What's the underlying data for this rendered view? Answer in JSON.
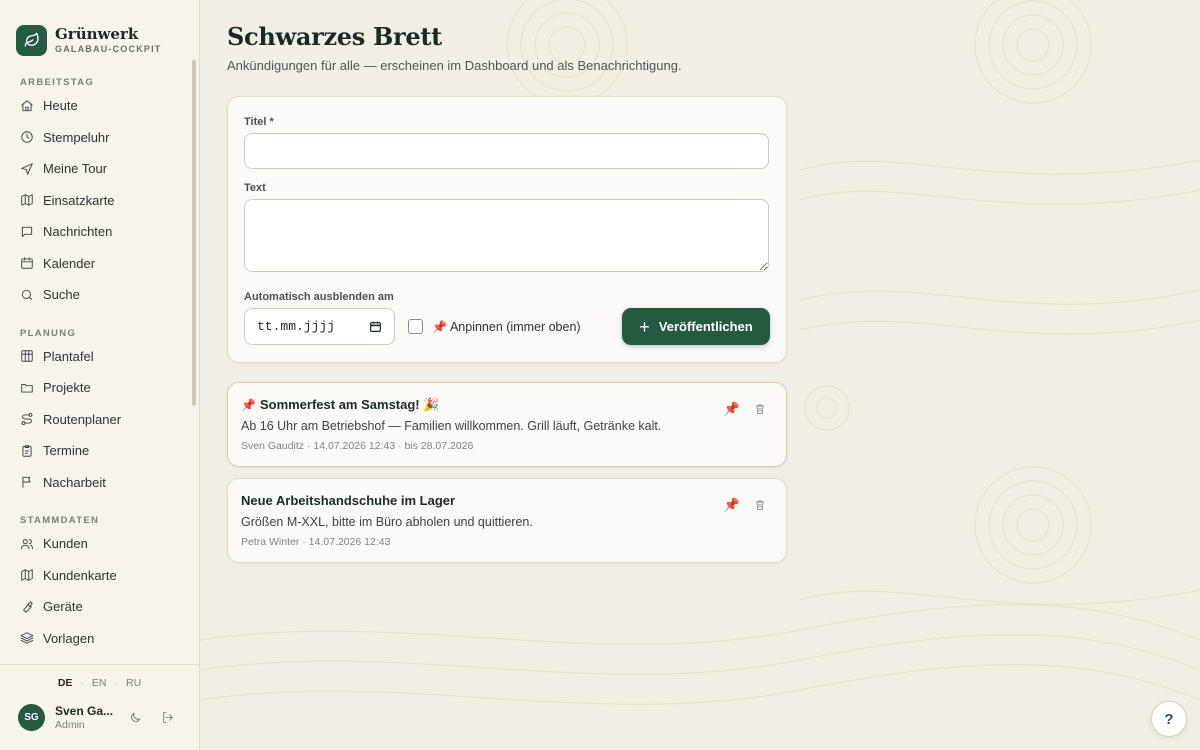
{
  "brand": {
    "name": "Grünwerk",
    "subtitle": "GALABAU-COCKPIT"
  },
  "sidebar": {
    "sections": [
      {
        "title": "ARBEITSTAG",
        "items": [
          {
            "label": "Heute",
            "icon": "home-icon"
          },
          {
            "label": "Stempeluhr",
            "icon": "clock-icon"
          },
          {
            "label": "Meine Tour",
            "icon": "navigation-icon"
          },
          {
            "label": "Einsatzkarte",
            "icon": "map-icon"
          },
          {
            "label": "Nachrichten",
            "icon": "message-icon"
          },
          {
            "label": "Kalender",
            "icon": "calendar-icon"
          },
          {
            "label": "Suche",
            "icon": "search-icon"
          }
        ]
      },
      {
        "title": "PLANUNG",
        "items": [
          {
            "label": "Plantafel",
            "icon": "grid-icon"
          },
          {
            "label": "Projekte",
            "icon": "folder-icon"
          },
          {
            "label": "Routenplaner",
            "icon": "route-icon"
          },
          {
            "label": "Termine",
            "icon": "clipboard-icon"
          },
          {
            "label": "Nacharbeit",
            "icon": "flag-icon"
          }
        ]
      },
      {
        "title": "STAMMDATEN",
        "items": [
          {
            "label": "Kunden",
            "icon": "users-icon"
          },
          {
            "label": "Kundenkarte",
            "icon": "map-icon"
          },
          {
            "label": "Geräte",
            "icon": "wrench-icon"
          },
          {
            "label": "Vorlagen",
            "icon": "layers-icon"
          }
        ]
      }
    ],
    "languages": [
      "DE",
      "EN",
      "RU"
    ],
    "active_language": "DE",
    "user": {
      "initials": "SG",
      "name": "Sven Ga...",
      "role": "Admin"
    }
  },
  "page": {
    "title": "Schwarzes Brett",
    "subtitle": "Ankündigungen für alle — erscheinen im Dashboard und als Benachrichtigung."
  },
  "form": {
    "title_label": "Titel *",
    "title_value": "",
    "text_label": "Text",
    "text_value": "",
    "hide_label": "Automatisch ausblenden am",
    "date_placeholder": "tt.mm.jjjj",
    "pin_emoji": "📌",
    "pin_label": "Anpinnen (immer oben)",
    "pin_checked": false,
    "publish_label": "Veröffentlichen"
  },
  "posts": [
    {
      "pinned": true,
      "title_prefix": "📌",
      "title": "Sommerfest am Samstag! 🎉",
      "body": "Ab 16 Uhr am Betriebshof — Familien willkommen. Grill läuft, Getränke kalt.",
      "meta": "Sven Gauditz · 14.07.2026 12:43 · bis 28.07.2026"
    },
    {
      "pinned": false,
      "title": "Neue Arbeitshandschuhe im Lager",
      "body": "Größen M-XXL, bitte im Büro abholen und quittieren.",
      "meta": "Petra Winter · 14.07.2026 12:43"
    }
  ],
  "action_pin_emoji": "📌",
  "help_label": "?",
  "colors": {
    "accent": "#235a40",
    "background": "#f2efe6",
    "pin": "#c83a2e"
  }
}
